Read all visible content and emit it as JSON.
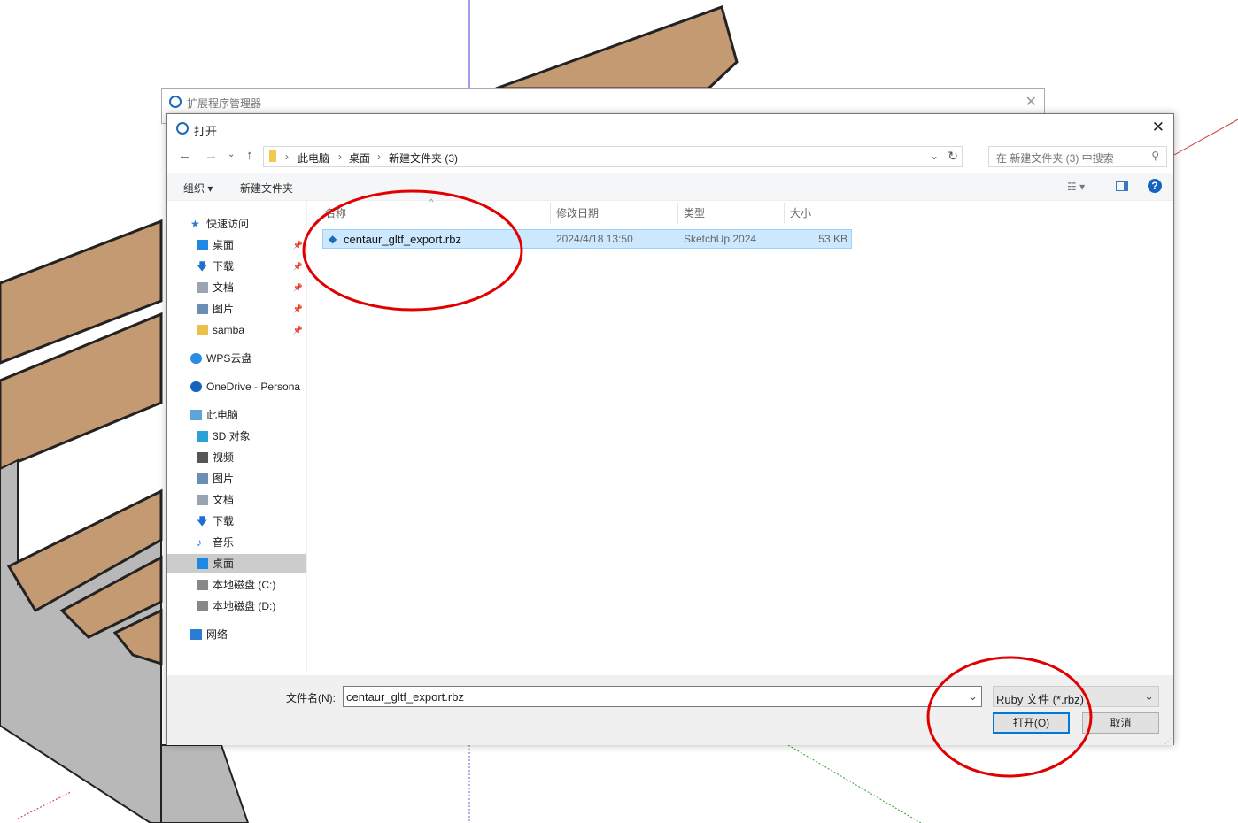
{
  "outer_window": {
    "title": "扩展程序管理器",
    "close_icon": "close-icon"
  },
  "dialog": {
    "title": "打开",
    "close_icon": "close-icon"
  },
  "address": {
    "crumbs": [
      "此电脑",
      "桌面",
      "新建文件夹 (3)"
    ],
    "search_placeholder": "在 新建文件夹 (3) 中搜索"
  },
  "toolbar": {
    "organize": "组织 ▾",
    "new_folder": "新建文件夹"
  },
  "sidebar": {
    "items": [
      {
        "label": "快速访问",
        "icon": "star-icon",
        "color": "#2b7cd3"
      },
      {
        "label": "桌面",
        "icon": "desktop-icon",
        "color": "#1e88e5",
        "pinned": true
      },
      {
        "label": "下载",
        "icon": "download-icon",
        "color": "#1e6fd0",
        "pinned": true
      },
      {
        "label": "文档",
        "icon": "document-icon",
        "color": "#9aa5b1",
        "pinned": true
      },
      {
        "label": "图片",
        "icon": "pictures-icon",
        "color": "#6b8fb3",
        "pinned": true
      },
      {
        "label": "samba",
        "icon": "folder-icon",
        "color": "#e8c04a",
        "pinned": true
      },
      {
        "label": "WPS云盘",
        "icon": "cloud-icon",
        "color": "#2a8de0"
      },
      {
        "label": "OneDrive - Persona",
        "icon": "onedrive-icon",
        "color": "#1565c0"
      },
      {
        "label": "此电脑",
        "icon": "computer-icon",
        "color": "#5fa4d8"
      },
      {
        "label": "3D 对象",
        "icon": "3d-objects-icon",
        "color": "#2ba1d8"
      },
      {
        "label": "视频",
        "icon": "video-icon",
        "color": "#555"
      },
      {
        "label": "图片",
        "icon": "pictures-icon",
        "color": "#6b8fb3"
      },
      {
        "label": "文档",
        "icon": "document-icon",
        "color": "#9aa5b1"
      },
      {
        "label": "下载",
        "icon": "download-icon",
        "color": "#1e6fd0"
      },
      {
        "label": "音乐",
        "icon": "music-icon",
        "color": "#1e6fd0"
      },
      {
        "label": "桌面",
        "icon": "desktop-icon",
        "color": "#1e88e5",
        "selected": true
      },
      {
        "label": "本地磁盘 (C:)",
        "icon": "drive-icon",
        "color": "#888"
      },
      {
        "label": "本地磁盘 (D:)",
        "icon": "drive-icon",
        "color": "#888"
      },
      {
        "label": "网络",
        "icon": "network-icon",
        "color": "#2b7cd3"
      }
    ]
  },
  "columns": [
    "名称",
    "修改日期",
    "类型",
    "大小"
  ],
  "files": [
    {
      "name": "centaur_gltf_export.rbz",
      "modified": "2024/4/18 13:50",
      "type": "SketchUp 2024",
      "size": "53 KB"
    }
  ],
  "footer": {
    "filename_label": "文件名(N):",
    "filename_value": "centaur_gltf_export.rbz",
    "filetype": "Ruby 文件 (*.rbz)",
    "open": "打开(O)",
    "cancel": "取消"
  },
  "colors": {
    "selection": "#cce8ff",
    "accent": "#0078d7",
    "annotation": "#e00000"
  }
}
